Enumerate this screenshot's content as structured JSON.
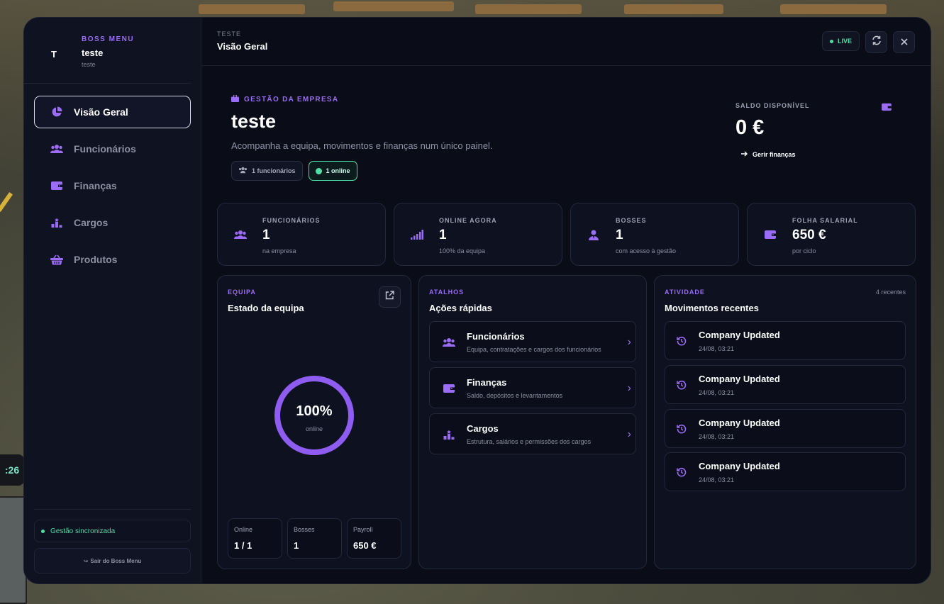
{
  "hud": {
    "clock_fragment": ":26"
  },
  "sidebar": {
    "brand_sub": "BOSS MENU",
    "avatar_letter": "T",
    "company_name": "teste",
    "company_sub": "teste",
    "items": [
      {
        "label": "Visão Geral",
        "icon": "chart-pie-icon",
        "active": true
      },
      {
        "label": "Funcionários",
        "icon": "users-icon",
        "active": false
      },
      {
        "label": "Finanças",
        "icon": "wallet-icon",
        "active": false
      },
      {
        "label": "Cargos",
        "icon": "ranks-icon",
        "active": false
      },
      {
        "label": "Produtos",
        "icon": "basket-icon",
        "active": false
      }
    ],
    "sync_status": "Gestão sincronizada",
    "leave_label": "Sair do Boss Menu"
  },
  "topbar": {
    "crumb": "TESTE",
    "title": "Visão Geral",
    "live_label": "LIVE"
  },
  "hero": {
    "tag": "GESTÃO DA EMPRESA",
    "title": "teste",
    "description": "Acompanha a equipa, movimentos e finanças num único painel.",
    "chip_employees": "1 funcionários",
    "chip_online": "1 online"
  },
  "balance": {
    "label": "SALDO DISPONÍVEL",
    "value": "0 €",
    "link": "Gerir finanças"
  },
  "stats": [
    {
      "label": "FUNCIONÁRIOS",
      "value": "1",
      "sub": "na empresa",
      "icon": "users-icon"
    },
    {
      "label": "ONLINE AGORA",
      "value": "1",
      "sub": "100% da equipa",
      "icon": "signal-icon"
    },
    {
      "label": "BOSSES",
      "value": "1",
      "sub": "com acesso à gestão",
      "icon": "user-tie-icon"
    },
    {
      "label": "FOLHA SALARIAL",
      "value": "650 €",
      "sub": "por ciclo",
      "icon": "wallet-icon"
    }
  ],
  "team": {
    "tag": "EQUIPA",
    "title": "Estado da equipa",
    "ring_value": "100%",
    "ring_sub": "online",
    "online_fraction": 1.0,
    "mini": [
      {
        "label": "Online",
        "value": "1 / 1"
      },
      {
        "label": "Bosses",
        "value": "1"
      },
      {
        "label": "Payroll",
        "value": "650 €"
      }
    ]
  },
  "shortcuts": {
    "tag": "ATALHOS",
    "title": "Ações rápidas",
    "items": [
      {
        "title": "Funcionários",
        "desc": "Equipa, contratações e cargos dos funcionários",
        "icon": "users-icon"
      },
      {
        "title": "Finanças",
        "desc": "Saldo, depósitos e levantamentos",
        "icon": "wallet-icon"
      },
      {
        "title": "Cargos",
        "desc": "Estrutura, salários e permissões dos cargos",
        "icon": "ranks-icon"
      }
    ]
  },
  "activity": {
    "tag": "ATIVIDADE",
    "count": "4 recentes",
    "title": "Movimentos recentes",
    "items": [
      {
        "title": "Company Updated",
        "time": "24/08, 03:21"
      },
      {
        "title": "Company Updated",
        "time": "24/08, 03:21"
      },
      {
        "title": "Company Updated",
        "time": "24/08, 03:21"
      },
      {
        "title": "Company Updated",
        "time": "24/08, 03:21"
      }
    ]
  },
  "colors": {
    "accent": "#9b6cf5",
    "online": "#4ee0a4",
    "panel_bg": "#0a0d18"
  }
}
